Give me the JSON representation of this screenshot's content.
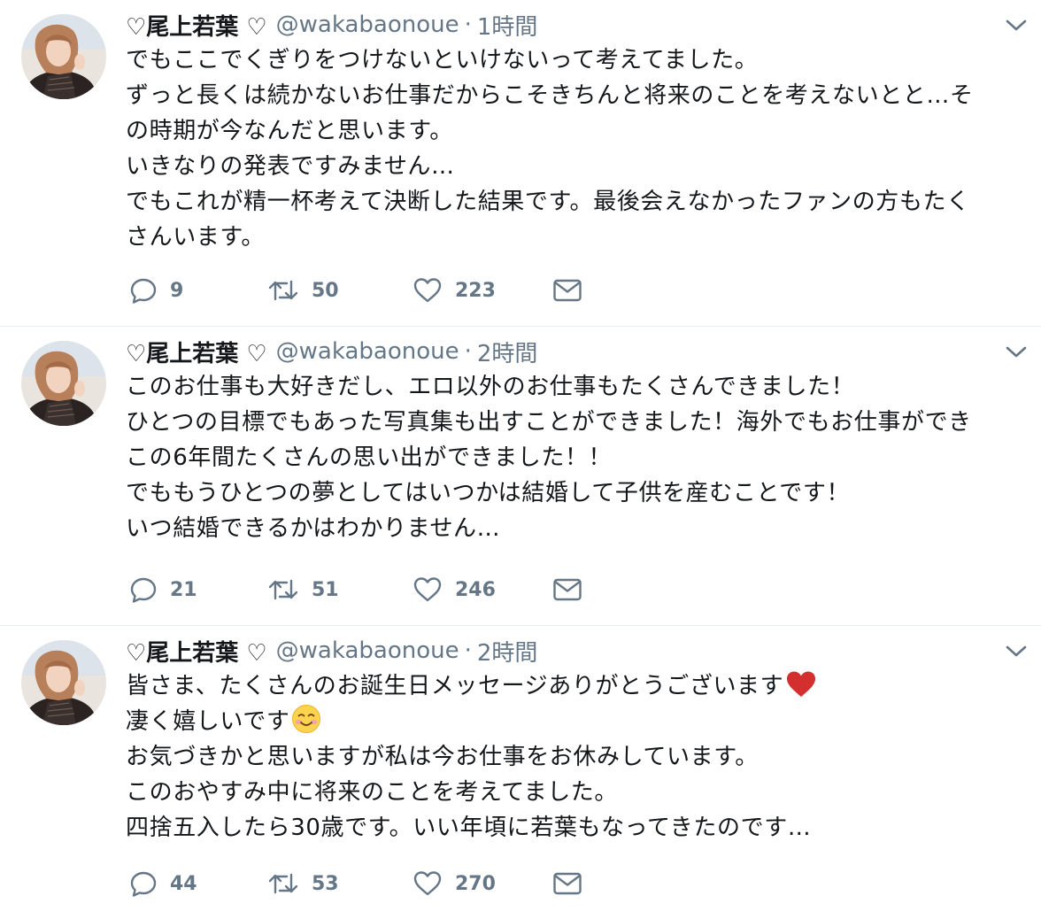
{
  "tweets": [
    {
      "name": "♡尾上若葉 ♡",
      "handle": "@wakabaonoue",
      "separator": "·",
      "time": "1時間",
      "lines": [
        "でもここでくぎりをつけないといけないって考えてました。",
        "ずっと長くは続かないお仕事だからこそきちんと将来のことを考えないとと…そ",
        "の時期が今なんだと思います。",
        "いきなりの発表ですみません…",
        "でもこれが精一杯考えて決断した結果です。最後会えなかったファンの方もたく",
        "さんいます。"
      ],
      "replies": "9",
      "retweets": "50",
      "likes": "223"
    },
    {
      "name": "♡尾上若葉 ♡",
      "handle": "@wakabaonoue",
      "separator": "·",
      "time": "2時間",
      "lines": [
        "このお仕事も大好きだし、エロ以外のお仕事もたくさんできました！",
        "ひとつの目標でもあった写真集も出すことができました！海外でもお仕事ができ",
        "この6年間たくさんの思い出ができました！！",
        "でももうひとつの夢としてはいつかは結婚して子供を産むことです！",
        "いつ結婚できるかはわかりません…"
      ],
      "replies": "21",
      "retweets": "51",
      "likes": "246"
    },
    {
      "name": "♡尾上若葉 ♡",
      "handle": "@wakabaonoue",
      "separator": "·",
      "time": "2時間",
      "lines": [
        "皆さま、たくさんのお誕生日メッセージありがとうございます",
        "凄く嬉しいです",
        "お気づきかと思いますが私は今お仕事をお休みしています。",
        "このおやすみ中に将来のことを考えてました。",
        "四捨五入したら30歳です。いい年頃に若葉もなってきたのです…"
      ],
      "replies": "44",
      "retweets": "53",
      "likes": "270"
    }
  ],
  "icons": {
    "reply": "reply-icon",
    "retweet": "retweet-icon",
    "like": "heart-icon",
    "dm": "envelope-icon",
    "more": "chevron-down-icon"
  },
  "colors": {
    "text": "#14171a",
    "secondary": "#657786",
    "divider": "#e6ecf0",
    "heart_emoji": "#d32f2f"
  }
}
